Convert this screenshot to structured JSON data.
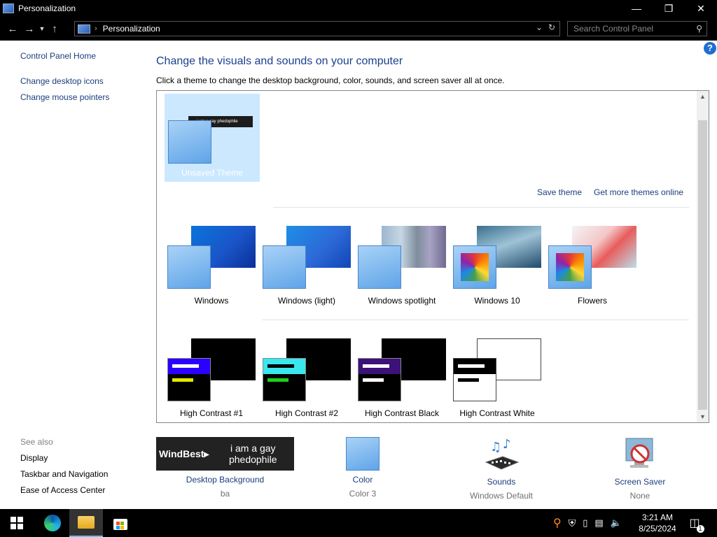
{
  "window": {
    "title": "Personalization"
  },
  "address": {
    "crumb": "Personalization",
    "search_placeholder": "Search Control Panel"
  },
  "left_pane": {
    "links": [
      "Control Panel Home",
      "Change desktop icons",
      "Change mouse pointers"
    ],
    "see_also_label": "See also",
    "see_also": [
      "Display",
      "Taskbar and Navigation",
      "Ease of Access Center"
    ]
  },
  "main": {
    "heading": "Change the visuals and sounds on your computer",
    "subtitle": "Click a theme to change the desktop background, color, sounds, and screen saver all at once.",
    "selected_theme": {
      "label": "Unsaved Theme",
      "caption": "i am a gay phedophile"
    },
    "save_theme": "Save theme",
    "more_themes": "Get more themes online",
    "themes": [
      {
        "label": "Windows"
      },
      {
        "label": "Windows (light)"
      },
      {
        "label": "Windows spotlight"
      },
      {
        "label": "Windows 10"
      },
      {
        "label": "Flowers"
      }
    ],
    "contrast_themes": [
      {
        "label": "High Contrast #1"
      },
      {
        "label": "High Contrast #2"
      },
      {
        "label": "High Contrast Black"
      },
      {
        "label": "High Contrast White"
      }
    ]
  },
  "bottom": {
    "desktop_background": {
      "name": "Desktop Background",
      "value": "ba",
      "preview_brand": "WindBest▸",
      "preview_text": "i am a gay phedophile"
    },
    "color": {
      "name": "Color",
      "value": "Color 3"
    },
    "sounds": {
      "name": "Sounds",
      "value": "Windows Default"
    },
    "screen_saver": {
      "name": "Screen Saver",
      "value": "None"
    }
  },
  "taskbar": {
    "time": "3:21 AM",
    "date": "8/25/2024",
    "notification_count": "1"
  },
  "colors": {
    "link": "#1a3e7c",
    "heading": "#1b3f8f",
    "accent": "#1f6fd1",
    "selection": "#cce8ff"
  }
}
